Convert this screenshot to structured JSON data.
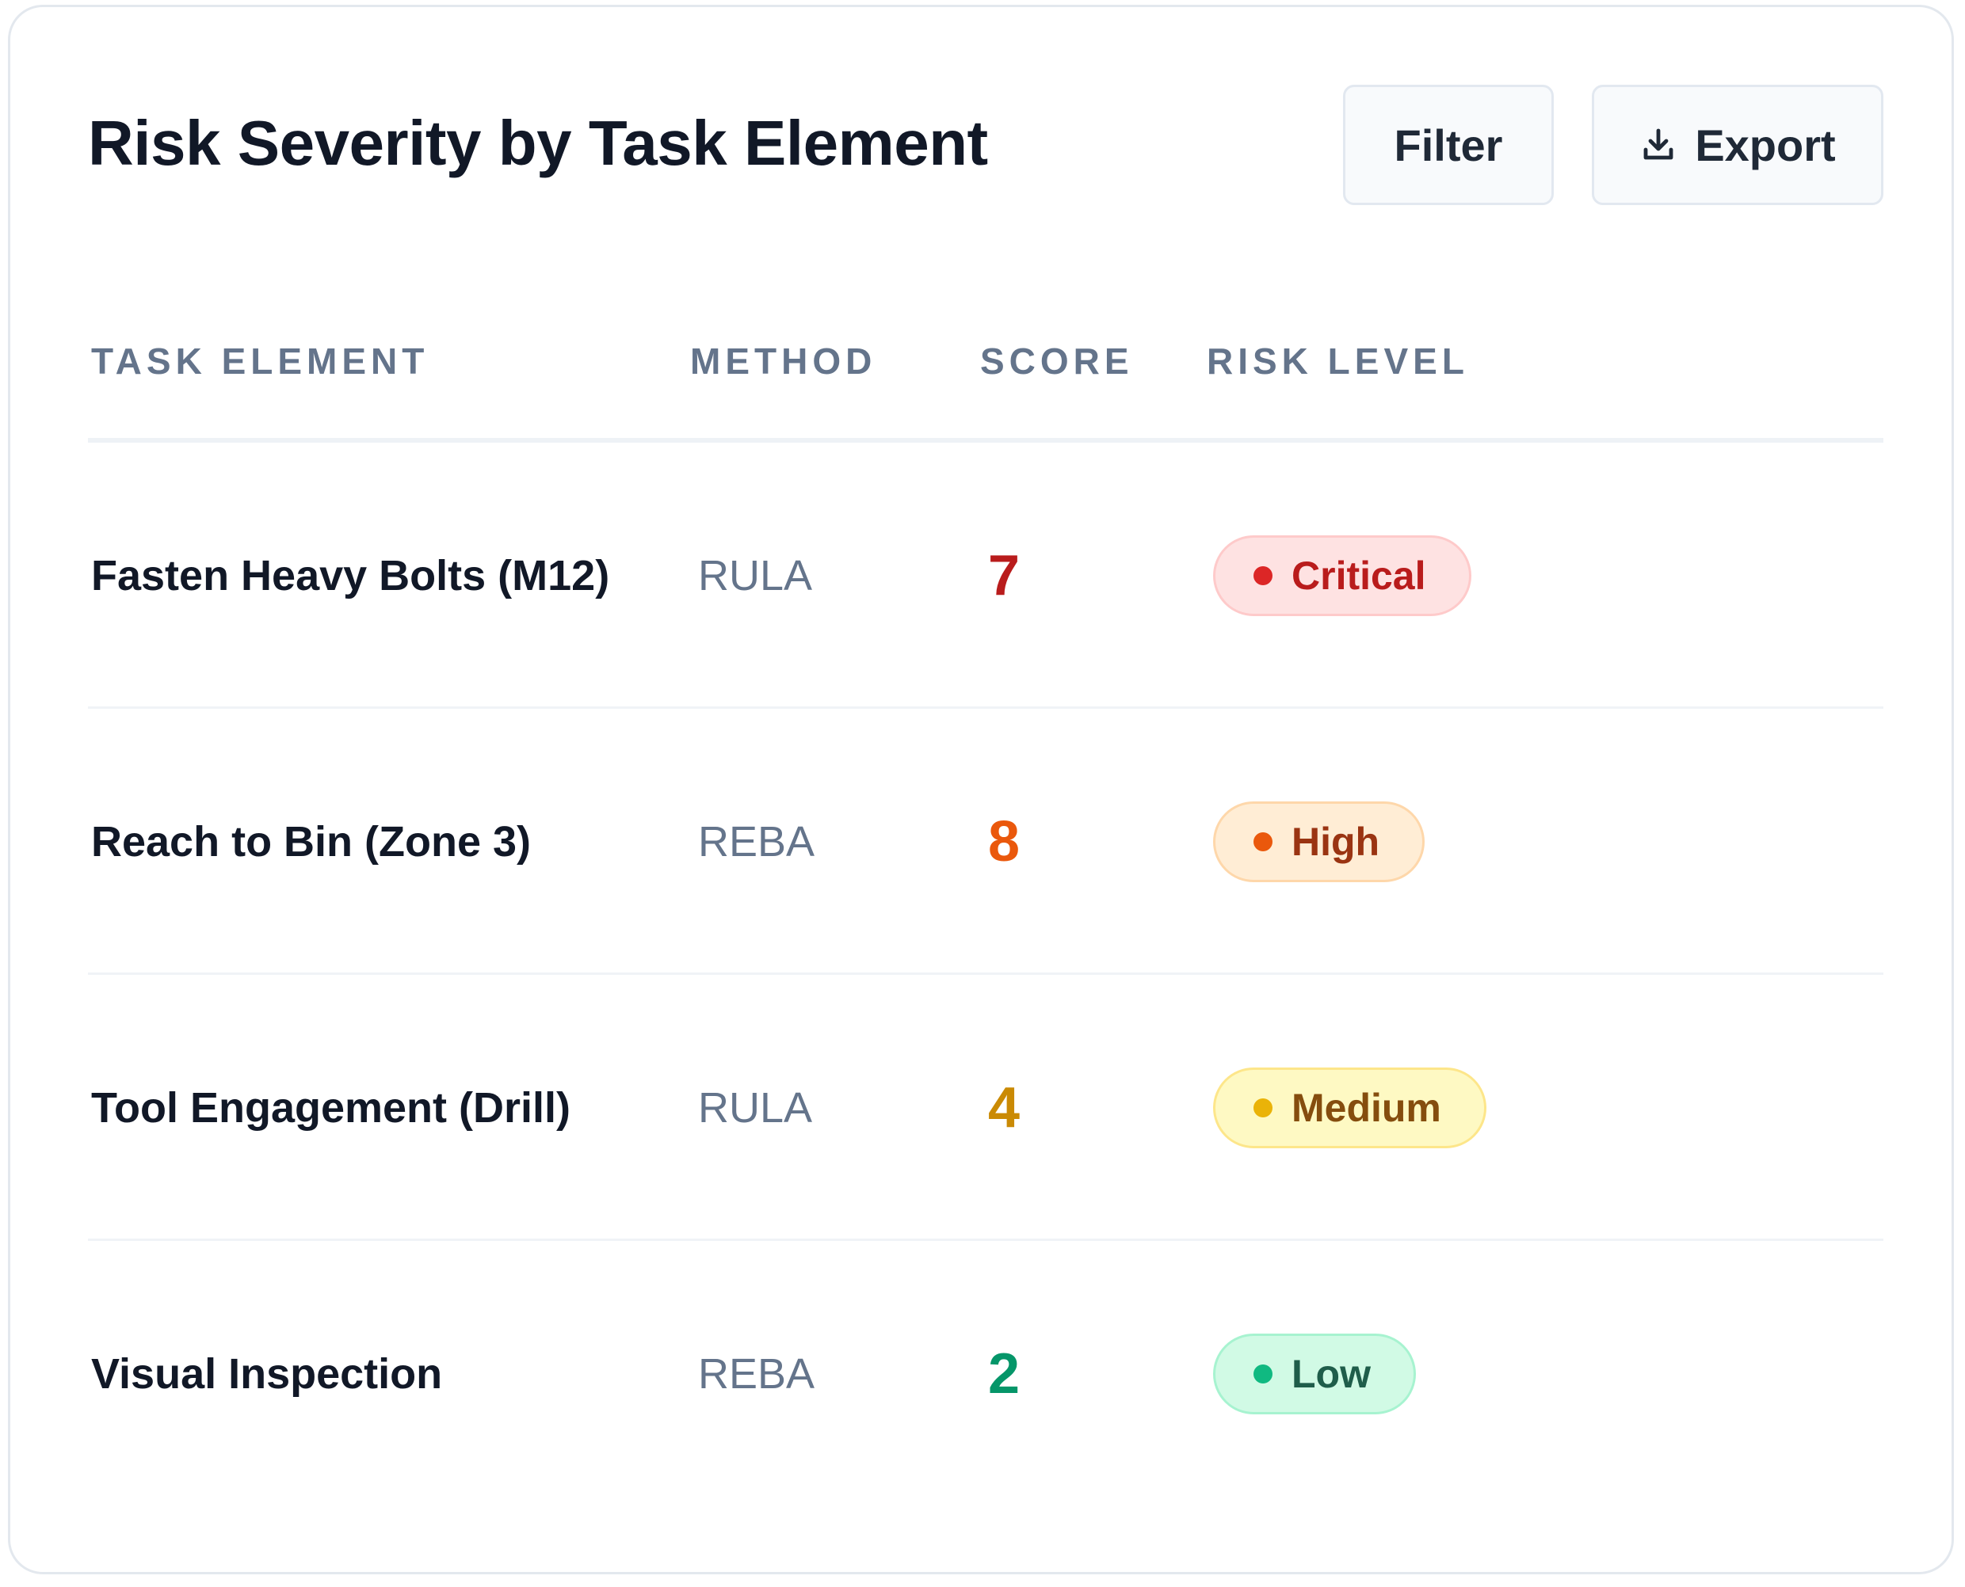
{
  "header": {
    "title": "Risk Severity by Task Element",
    "filter_label": "Filter",
    "export_label": "Export"
  },
  "table": {
    "columns": [
      "TASK ELEMENT",
      "METHOD",
      "SCORE",
      "RISK LEVEL"
    ],
    "rows": [
      {
        "task": "Fasten Heavy Bolts (M12)",
        "method": "RULA",
        "score": "7",
        "risk": "Critical"
      },
      {
        "task": "Reach to Bin (Zone 3)",
        "method": "REBA",
        "score": "8",
        "risk": "High"
      },
      {
        "task": "Tool Engagement (Drill)",
        "method": "RULA",
        "score": "4",
        "risk": "Medium"
      },
      {
        "task": "Visual Inspection",
        "method": "REBA",
        "score": "2",
        "risk": "Low"
      }
    ]
  },
  "colors": {
    "critical": {
      "text": "#b91c1c",
      "score": "#b91c1c",
      "bg": "#fee2e2",
      "border": "#fecaca",
      "dot": "#dc2626"
    },
    "high": {
      "text": "#9a3412",
      "score": "#ea580c",
      "bg": "#ffedd5",
      "border": "#fed7aa",
      "dot": "#ea580c"
    },
    "medium": {
      "text": "#854d0e",
      "score": "#ca8a04",
      "bg": "#fef9c3",
      "border": "#fde68a",
      "dot": "#eab308"
    },
    "low": {
      "text": "#1f5d4a",
      "score": "#059669",
      "bg": "#d1fae5",
      "border": "#a7f3d0",
      "dot": "#10b981"
    }
  },
  "icons": {
    "export": "download-icon"
  }
}
